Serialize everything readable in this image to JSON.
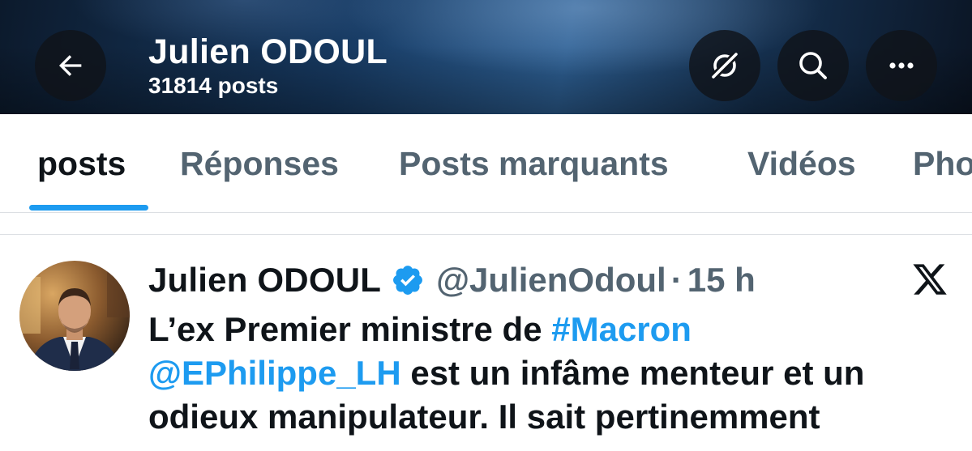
{
  "header": {
    "title": "Julien ODOUL",
    "post_count": "31814 posts",
    "icons": [
      "back-arrow-icon",
      "grok-icon",
      "search-icon",
      "more-icon"
    ]
  },
  "tabs": [
    {
      "label": "posts",
      "active": true
    },
    {
      "label": "Réponses",
      "active": false
    },
    {
      "label": "Posts marquants",
      "active": false
    },
    {
      "label": "Vidéos",
      "active": false
    },
    {
      "label": "Pho",
      "active": false
    }
  ],
  "tweet": {
    "author_name": "Julien ODOUL",
    "handle": "@JulienOdoul",
    "separator": "·",
    "time": "15 h",
    "line1_text": "L’ex Premier ministre de ",
    "line1_hashtag": "#Macron",
    "line2_mention": "@EPhilippe_LH",
    "line2_text": " est un infâme menteur et un",
    "line3_text": "odieux manipulateur. Il sait pertinemment"
  },
  "colors": {
    "accent": "#1d9bf0",
    "text_primary": "#0f1419",
    "text_secondary": "#536471"
  }
}
